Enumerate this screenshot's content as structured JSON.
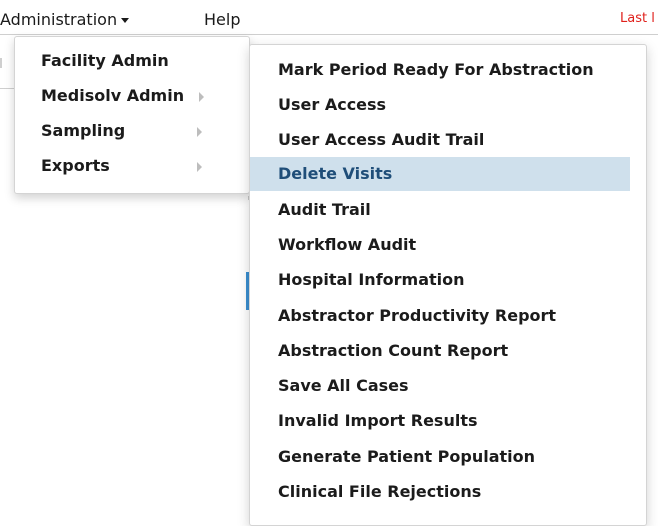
{
  "navbar": {
    "administration_label": "Administration",
    "help_label": "Help",
    "last_link_label": "Last l"
  },
  "admin_menu": {
    "items": [
      {
        "label": "Facility Admin",
        "has_submenu": false
      },
      {
        "label": "Medisolv Admin",
        "has_submenu": true
      },
      {
        "label": "Sampling",
        "has_submenu": true
      },
      {
        "label": "Exports",
        "has_submenu": true
      }
    ]
  },
  "medisolv_submenu": {
    "highlighted_index": 3,
    "items": [
      {
        "label": "Mark Period Ready For Abstraction"
      },
      {
        "label": "User Access"
      },
      {
        "label": "User Access Audit Trail"
      },
      {
        "label": "Delete Visits"
      },
      {
        "label": "Audit Trail"
      },
      {
        "label": "Workflow Audit"
      },
      {
        "label": "Hospital Information"
      },
      {
        "label": "Abstractor Productivity Report"
      },
      {
        "label": "Abstraction Count Report"
      },
      {
        "label": "Save All Cases"
      },
      {
        "label": "Invalid Import Results"
      },
      {
        "label": "Generate Patient Population"
      },
      {
        "label": "Clinical File Rejections"
      }
    ]
  },
  "colors": {
    "highlight_bg": "#cfe0ec",
    "highlight_text": "#1f4e79",
    "last_link": "#e0201b"
  }
}
